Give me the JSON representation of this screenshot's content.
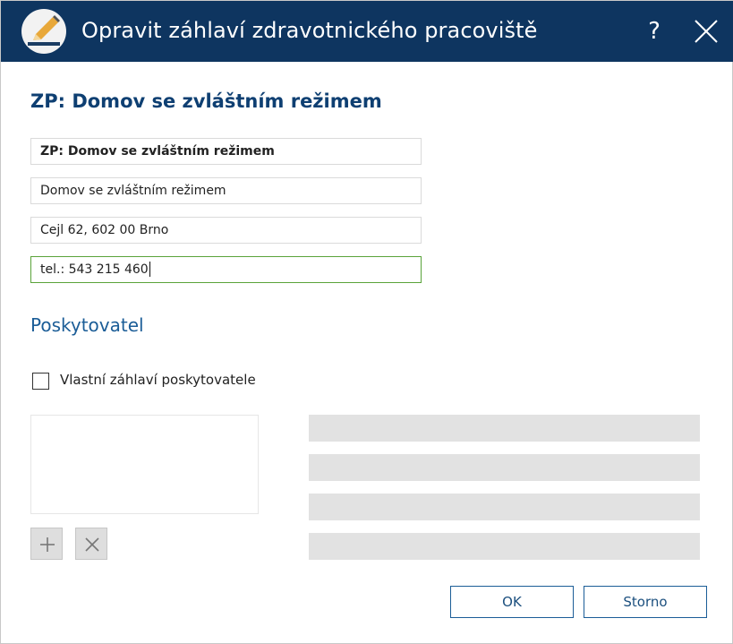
{
  "window": {
    "title": "Opravit záhlaví zdravotnického pracoviště",
    "help_label": "?",
    "accent_color": "#0e3560"
  },
  "workplace": {
    "heading": "ZP: Domov se zvláštním režimem",
    "lines": [
      "ZP: Domov se zvláštním režimem",
      "Domov se zvláštním režimem",
      "Cejl 62, 602 00 Brno",
      "tel.: 543 215 460"
    ]
  },
  "provider": {
    "section_title": "Poskytovatel",
    "custom_header_label": "Vlastní záhlaví poskytovatele",
    "custom_header_checked": false,
    "add_icon": "plus-icon",
    "remove_icon": "x-icon"
  },
  "buttons": {
    "ok": "OK",
    "cancel": "Storno"
  }
}
